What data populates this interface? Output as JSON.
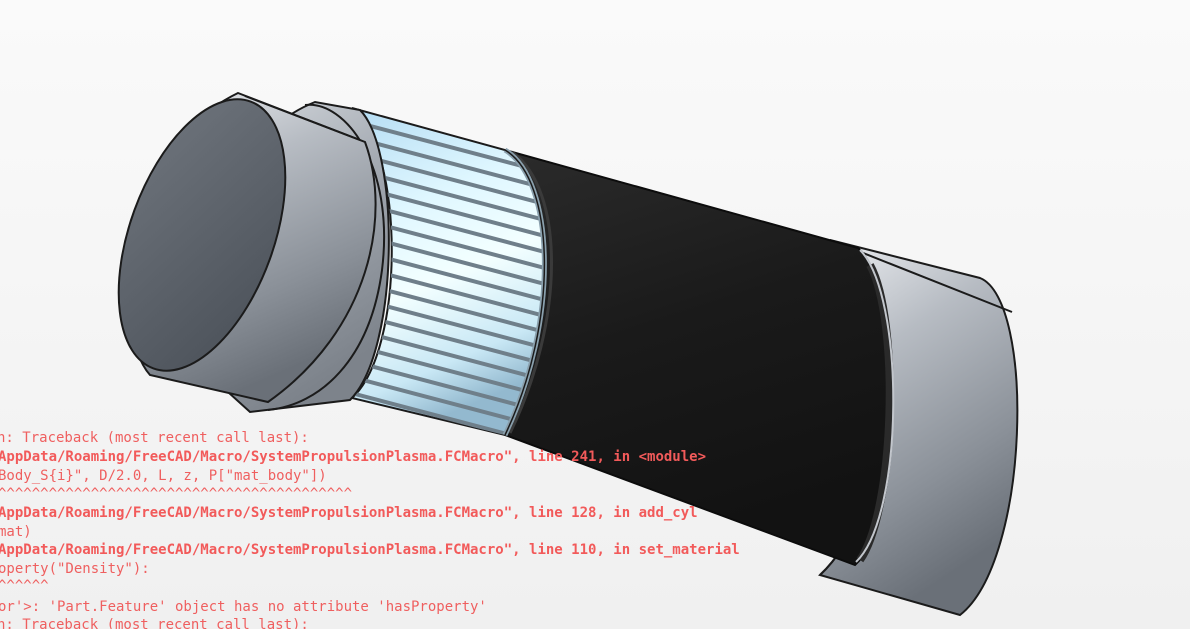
{
  "report_view": {
    "lines": [
      "n: Traceback (most recent call last):",
      "AppData/Roaming/FreeCAD/Macro/SystemPropulsionPlasma.FCMacro\", line 241, in <module>",
      "Body_S{i}\", D/2.0, L, z, P[\"mat_body\"])",
      "^^^^^^^^^^^^^^^^^^^^^^^^^^^^^^^^^^^^^^^^^^",
      "AppData/Roaming/FreeCAD/Macro/SystemPropulsionPlasma.FCMacro\", line 128, in add_cyl",
      "mat)",
      "AppData/Roaming/FreeCAD/Macro/SystemPropulsionPlasma.FCMacro\", line 110, in set_material",
      "operty(\"Density\"):",
      "^^^^^^",
      "or'>: 'Part.Feature' object has no attribute 'hasProperty'",
      "n: Traceback (most recent call last):"
    ]
  },
  "colors": {
    "error_text": "#ef5f5f",
    "background": "#f2f2f2",
    "body_black": "#1c1c1c",
    "coil_light": "#e6fbff"
  }
}
